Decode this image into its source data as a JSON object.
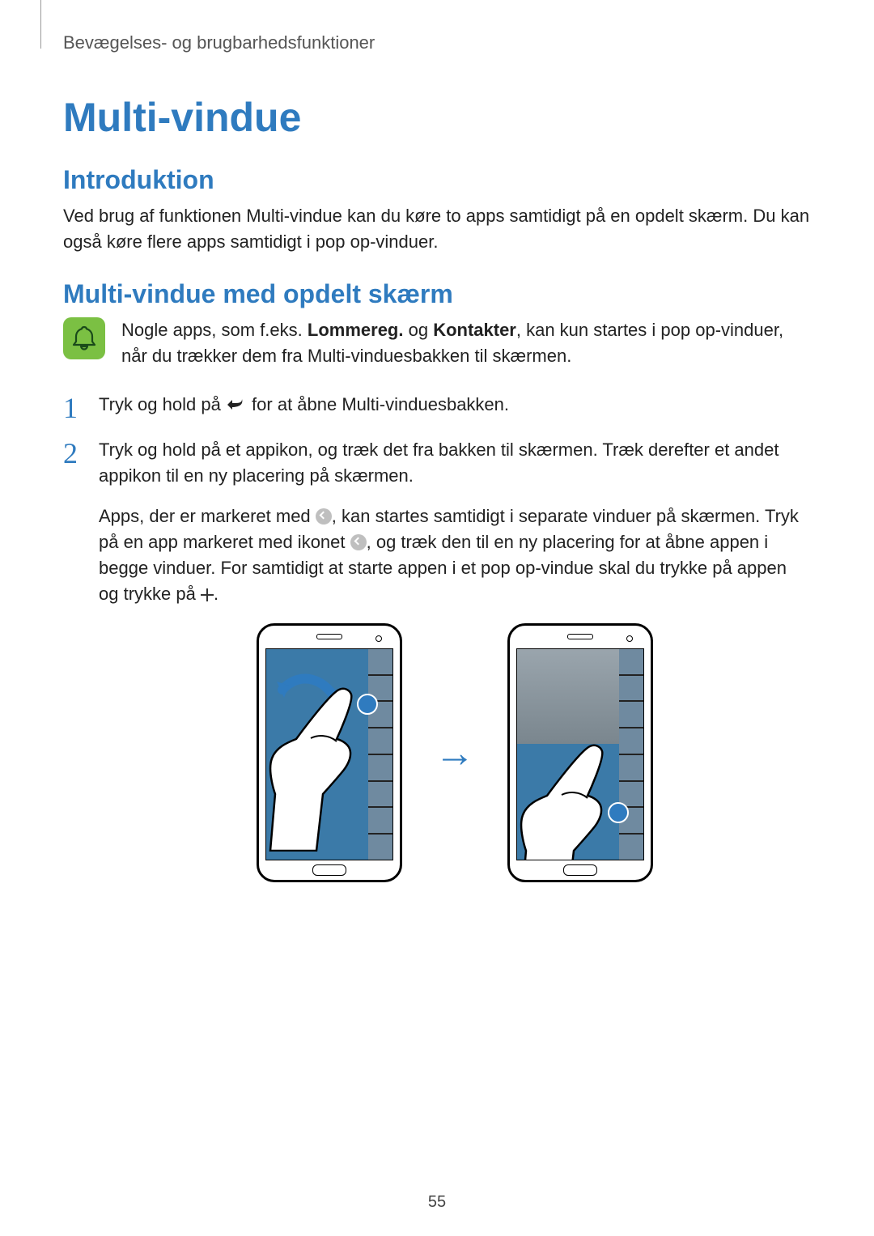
{
  "running_head": "Bevægelses- og brugbarhedsfunktioner",
  "title": "Multi-vindue",
  "section_intro": "Introduktion",
  "intro_body": "Ved brug af funktionen Multi-vindue kan du køre to apps samtidigt på en opdelt skærm. Du kan også køre flere apps samtidigt i pop op-vinduer.",
  "section_split": "Multi-vindue med opdelt skærm",
  "note": {
    "pre": "Nogle apps, som f.eks. ",
    "b1": "Lommereg.",
    "mid": " og ",
    "b2": "Kontakter",
    "post": ", kan kun startes i pop op-vinduer, når du trækker dem fra Multi-vinduesbakken til skærmen."
  },
  "step1": {
    "pre": "Tryk og hold på ",
    "post": " for at åbne Multi-vinduesbakken."
  },
  "step2": {
    "line1": "Tryk og hold på et appikon, og træk det fra bakken til skærmen. Træk derefter et andet appikon til en ny placering på skærmen.",
    "para_a": "Apps, der er markeret med ",
    "para_b": ", kan startes samtidigt i separate vinduer på skærmen. Tryk på en app markeret med ikonet ",
    "para_c": ", og træk den til en ny placering for at åbne appen i begge vinduer. For samtidigt at starte appen i et pop op-vindue skal du trykke på appen og trykke på ",
    "para_d": "."
  },
  "page_number": "55"
}
